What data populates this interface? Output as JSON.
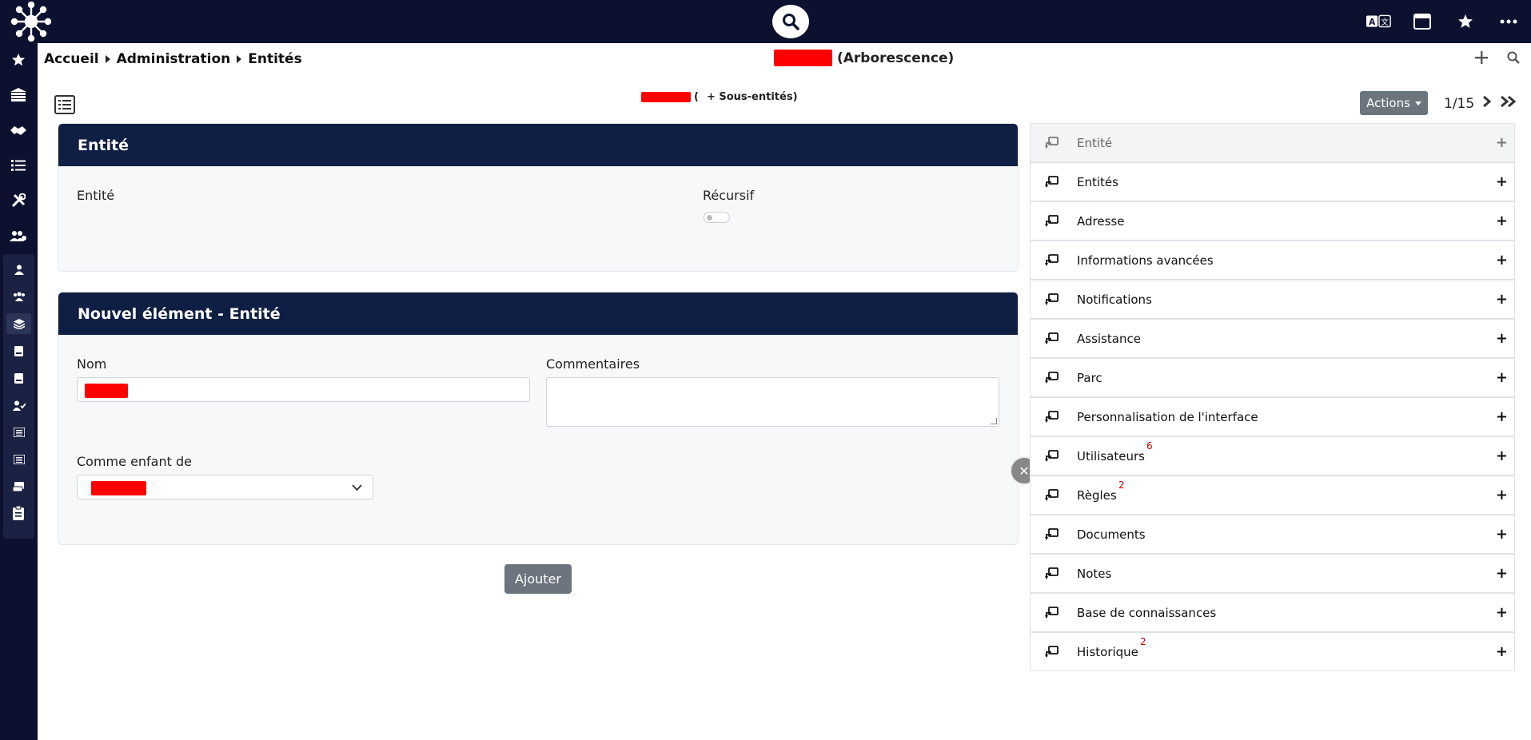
{
  "breadcrumb": [
    "Accueil",
    "Administration",
    "Entités"
  ],
  "page_title_suffix": "(Arborescence)",
  "subheading": {
    "open": "(",
    "text": "+ Sous-entités)"
  },
  "actions_label": "Actions",
  "pager": "1/15",
  "card1": {
    "title": "Entité",
    "field_label": "Entité",
    "recursive_label": "Récursif"
  },
  "card2": {
    "title": "Nouvel élément - Entité",
    "name_label": "Nom",
    "comments_label": "Commentaires",
    "parent_label": "Comme enfant de"
  },
  "add_button": "Ajouter",
  "tabs": [
    {
      "label": "Entité",
      "badge": ""
    },
    {
      "label": "Entités",
      "badge": ""
    },
    {
      "label": "Adresse",
      "badge": ""
    },
    {
      "label": "Informations avancées",
      "badge": ""
    },
    {
      "label": "Notifications",
      "badge": ""
    },
    {
      "label": "Assistance",
      "badge": ""
    },
    {
      "label": "Parc",
      "badge": ""
    },
    {
      "label": "Personnalisation de l'interface",
      "badge": ""
    },
    {
      "label": "Utilisateurs",
      "badge": "6"
    },
    {
      "label": "Règles",
      "badge": "2"
    },
    {
      "label": "Documents",
      "badge": ""
    },
    {
      "label": "Notes",
      "badge": ""
    },
    {
      "label": "Base de connaissances",
      "badge": ""
    },
    {
      "label": "Historique",
      "badge": "2"
    }
  ],
  "colors": {
    "nav": "#0c1130",
    "card_header": "#0f1f43",
    "redaction": "#ff0000",
    "button": "#6c757d"
  }
}
